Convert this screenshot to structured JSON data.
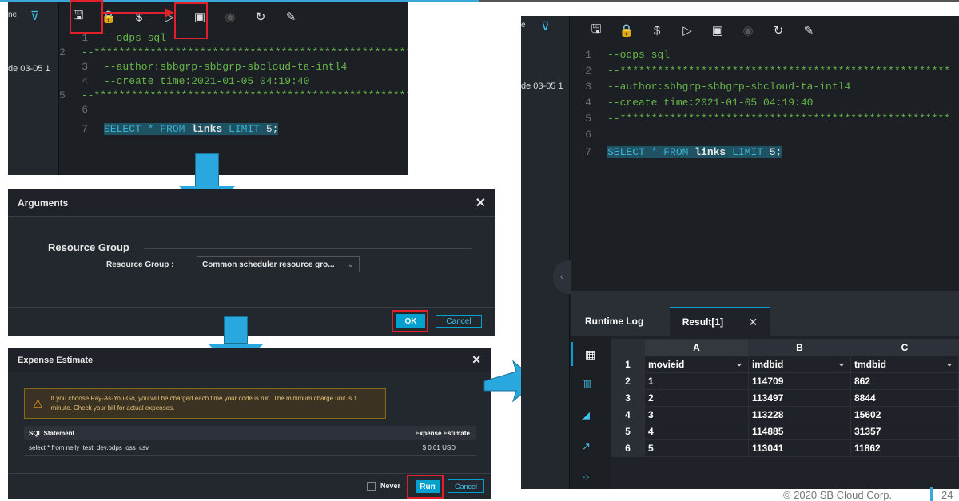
{
  "editor_lines": [
    {
      "n": "1",
      "t": "--odps sql",
      "c": "cmt"
    },
    {
      "n": "2",
      "t": "--*****************************************************",
      "c": "cmt"
    },
    {
      "n": "3",
      "t": "--author:sbbgrp-sbbgrp-sbcloud-ta-intl4",
      "c": "cmt"
    },
    {
      "n": "4",
      "t": "--create time:2021-01-05 04:19:40",
      "c": "cmt"
    },
    {
      "n": "5",
      "t": "--*****************************************************",
      "c": "cmt"
    },
    {
      "n": "6",
      "t": "",
      "c": "cmt"
    }
  ],
  "query": {
    "n": "7",
    "kw1": "SELECT * FROM ",
    "table": "links",
    "kw2": " LIMIT ",
    "limit": "5;"
  },
  "side_frag_left": "ne",
  "side_date": "de 03-05 1",
  "side_date_right": "de 03-05 1",
  "arguments_dialog": {
    "title": "Arguments",
    "section": "Resource Group",
    "field_label": "Resource Group :",
    "field_value": "Common scheduler resource gro...",
    "ok": "OK",
    "cancel": "Cancel"
  },
  "expense_dialog": {
    "title": "Expense Estimate",
    "warning": "If you choose Pay-As-You-Go, you will be charged each time your code is run. The minimum charge unit is 1 minute. Check your bill for actual expenses.",
    "col_sql": "SQL Statement",
    "col_est": "Expense Estimate",
    "row_sql": "select * from nelly_test_dev.odps_oss_csv",
    "row_est": "$ 0.01 USD",
    "never": "Never",
    "run": "Run",
    "cancel": "Cancel"
  },
  "results": {
    "tab_log": "Runtime Log",
    "tab_result": "Result[1]",
    "cols": [
      "A",
      "B",
      "C"
    ],
    "rows": [
      [
        "1",
        "movieid",
        "imdbid",
        "tmdbid"
      ],
      [
        "2",
        "1",
        "114709",
        "862"
      ],
      [
        "3",
        "2",
        "113497",
        "8844"
      ],
      [
        "4",
        "3",
        "113228",
        "15602"
      ],
      [
        "5",
        "4",
        "114885",
        "31357"
      ],
      [
        "6",
        "5",
        "113041",
        "11862"
      ]
    ]
  },
  "footer": {
    "copyright": "© 2020 SB Cloud Corp.",
    "page": "24"
  },
  "colors": {
    "accent": "#00a1cf",
    "highlight": "#e0202a",
    "arrow": "#29a8e0"
  }
}
